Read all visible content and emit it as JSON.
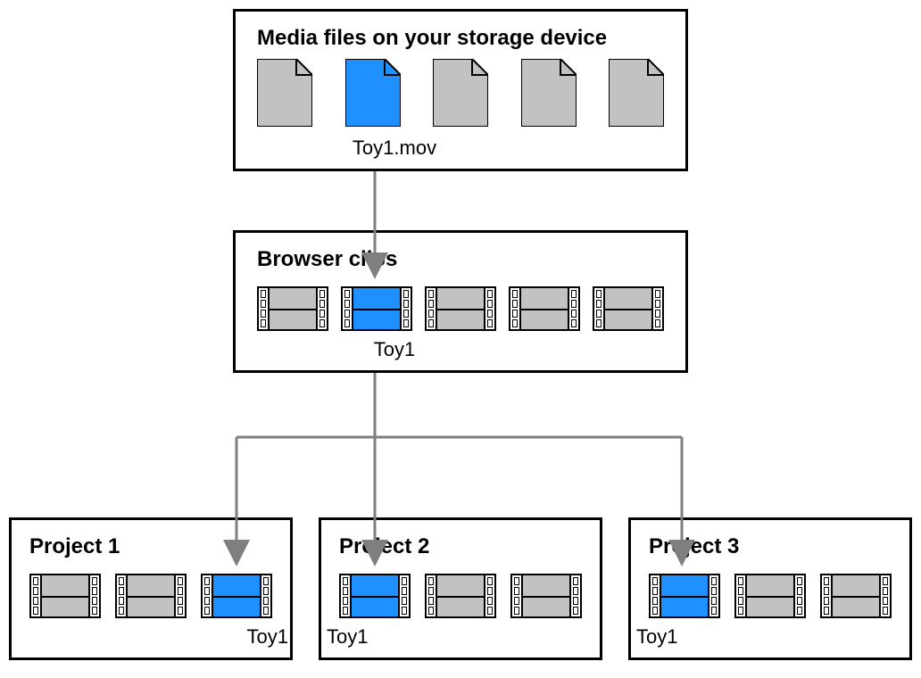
{
  "top_box": {
    "title": "Media files on your storage device",
    "files": [
      {
        "selected": false
      },
      {
        "selected": true,
        "label": "Toy1.mov"
      },
      {
        "selected": false
      },
      {
        "selected": false
      },
      {
        "selected": false
      }
    ]
  },
  "middle_box": {
    "title": "Browser clips",
    "clips": [
      {
        "selected": false
      },
      {
        "selected": true,
        "label": "Toy1"
      },
      {
        "selected": false
      },
      {
        "selected": false
      },
      {
        "selected": false
      }
    ]
  },
  "projects": [
    {
      "title": "Project 1",
      "clips": [
        {
          "selected": false
        },
        {
          "selected": false
        },
        {
          "selected": true,
          "label": "Toy1"
        }
      ]
    },
    {
      "title": "Project 2",
      "clips": [
        {
          "selected": true,
          "label": "Toy1"
        },
        {
          "selected": false
        },
        {
          "selected": false
        }
      ]
    },
    {
      "title": "Project 3",
      "clips": [
        {
          "selected": true,
          "label": "Toy1"
        },
        {
          "selected": false
        },
        {
          "selected": false
        }
      ]
    }
  ],
  "colors": {
    "selected": "#1e90ff",
    "unselected": "#c2c2c2",
    "arrow": "#7f7f7f",
    "border": "#000000"
  }
}
